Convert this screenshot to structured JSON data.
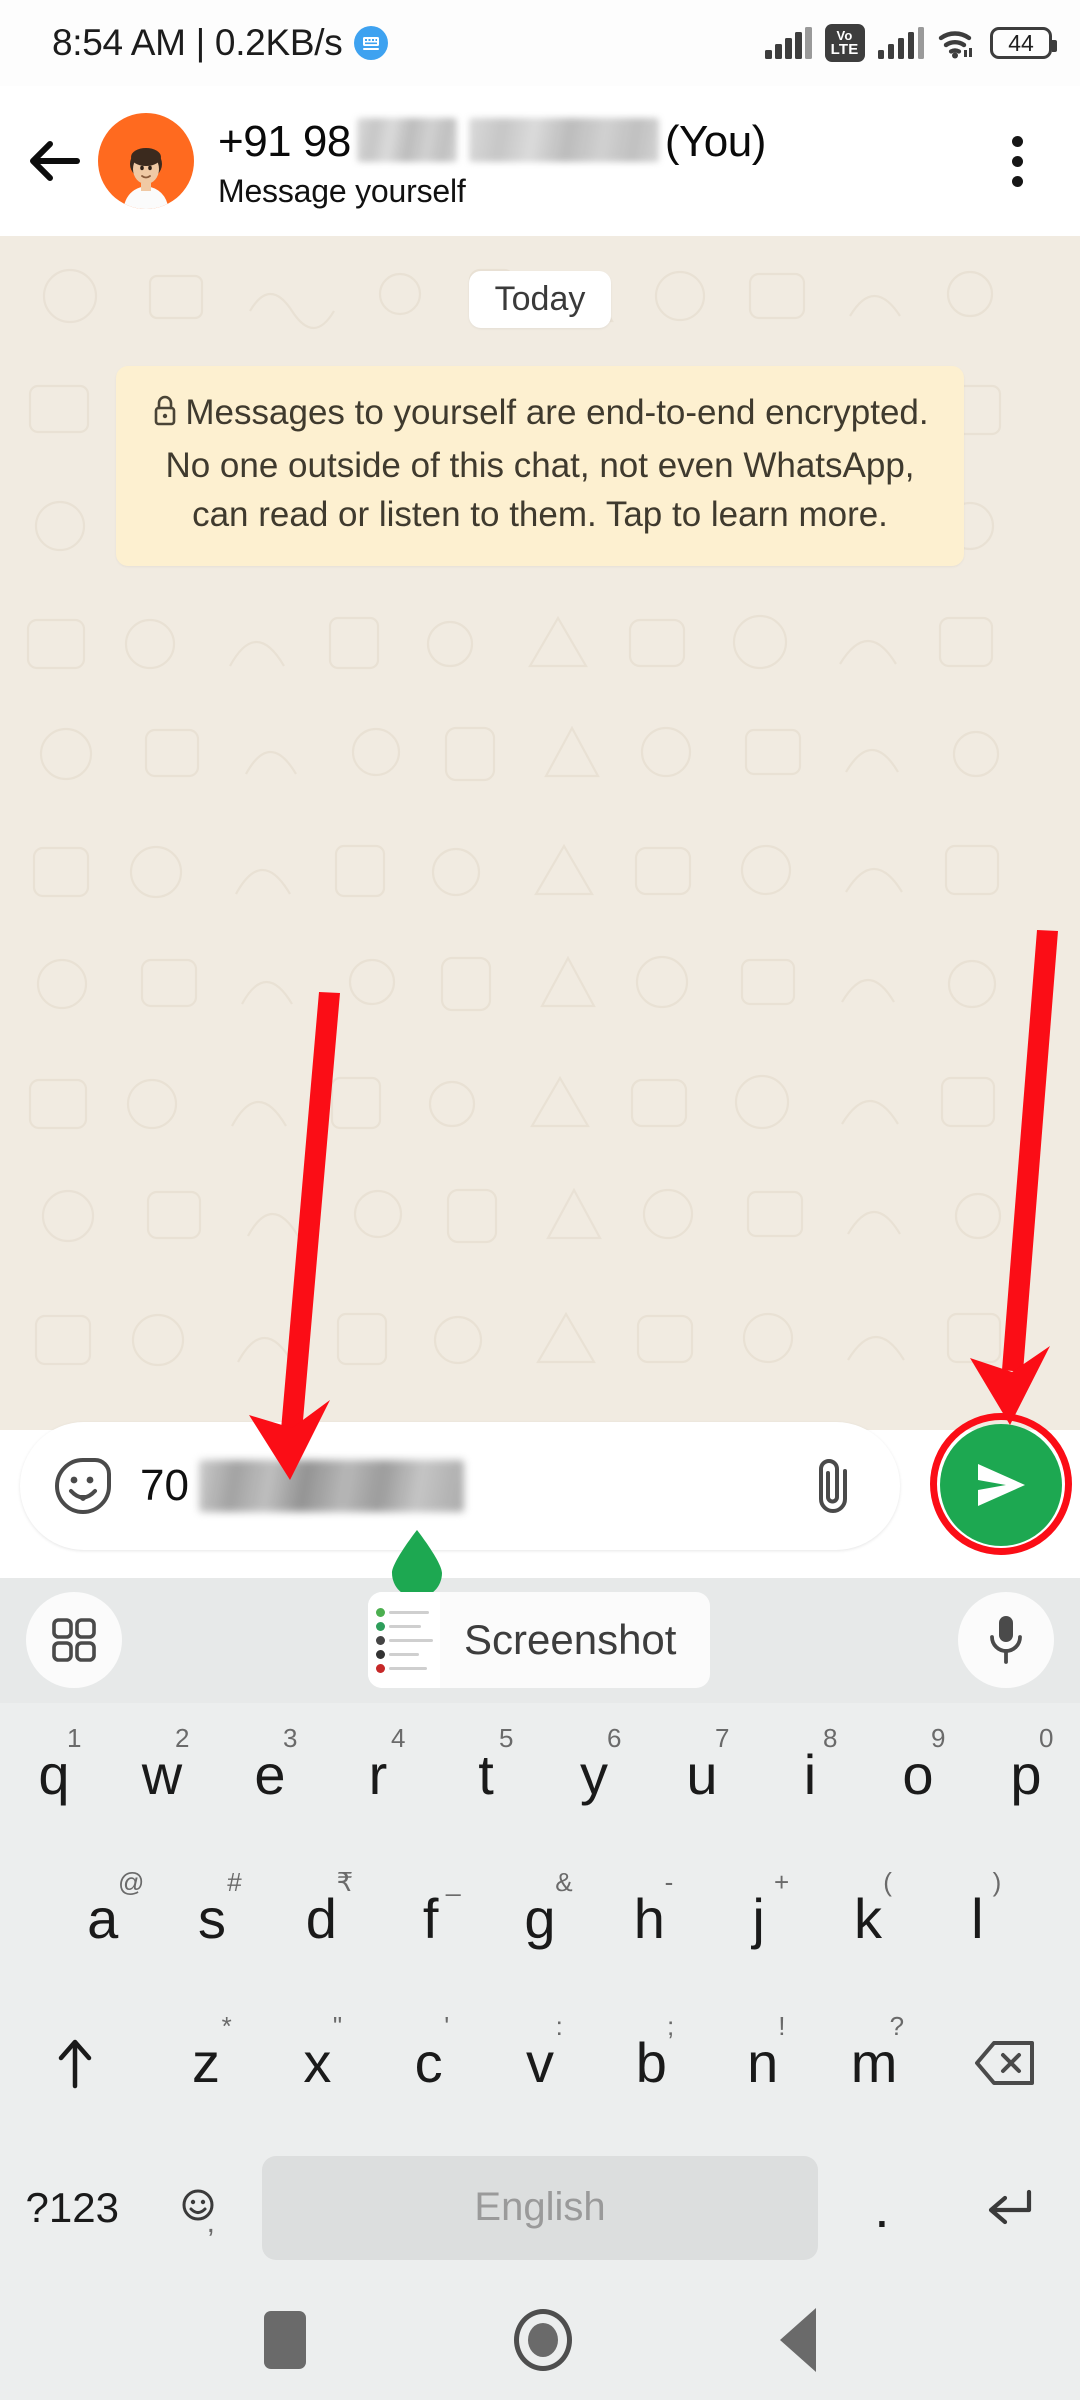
{
  "status_bar": {
    "time": "8:54 AM | 0.2KB/s",
    "network_badge_icon": "data-saver-icon",
    "signal_icon": "signal-bars-icon",
    "volte_line1": "Vo",
    "volte_line2": "LTE",
    "signal2_icon": "signal-bars-icon",
    "wifi_icon": "wifi-icon",
    "battery_level": "44"
  },
  "app_bar": {
    "back_icon": "back-arrow-icon",
    "avatar_icon": "contact-avatar",
    "title_prefix": "+91 98",
    "title_suffix": "(You)",
    "subtitle": "Message yourself",
    "menu_icon": "overflow-menu-icon"
  },
  "chat": {
    "day_chip": "Today",
    "lock_icon": "lock-icon",
    "encryption_notice": "Messages to yourself are end-to-end encrypted. No one outside of this chat, not even WhatsApp, can read or listen to them. Tap to learn more."
  },
  "annotations": {
    "arrow_left_target": "message-input-field",
    "arrow_right_target": "send-button",
    "highlight_color": "#fb0d16"
  },
  "input_bar": {
    "sticker_icon": "sticker-emoji-icon",
    "message_value": "70",
    "attach_icon": "paperclip-icon",
    "send_icon": "send-plane-icon",
    "send_button_color": "#1da851",
    "cursor_handle_color": "#1da851"
  },
  "suggestion_bar": {
    "left_icon": "grid-apps-icon",
    "clipboard_chip_label": "Screenshot",
    "clipboard_thumb_icon": "screenshot-thumbnail",
    "right_icon": "microphone-icon"
  },
  "keyboard": {
    "row1": [
      {
        "main": "q",
        "sup": "1"
      },
      {
        "main": "w",
        "sup": "2"
      },
      {
        "main": "e",
        "sup": "3"
      },
      {
        "main": "r",
        "sup": "4"
      },
      {
        "main": "t",
        "sup": "5"
      },
      {
        "main": "y",
        "sup": "6"
      },
      {
        "main": "u",
        "sup": "7"
      },
      {
        "main": "i",
        "sup": "8"
      },
      {
        "main": "o",
        "sup": "9"
      },
      {
        "main": "p",
        "sup": "0"
      }
    ],
    "row2": [
      {
        "main": "a",
        "sup": "@"
      },
      {
        "main": "s",
        "sup": "#"
      },
      {
        "main": "d",
        "sup": "₹"
      },
      {
        "main": "f",
        "sup": "_"
      },
      {
        "main": "g",
        "sup": "&"
      },
      {
        "main": "h",
        "sup": "-"
      },
      {
        "main": "j",
        "sup": "+"
      },
      {
        "main": "k",
        "sup": "("
      },
      {
        "main": "l",
        "sup": ")"
      }
    ],
    "row3": [
      {
        "main": "z",
        "sup": "*"
      },
      {
        "main": "x",
        "sup": "\""
      },
      {
        "main": "c",
        "sup": "'"
      },
      {
        "main": "v",
        "sup": ":"
      },
      {
        "main": "b",
        "sup": ";"
      },
      {
        "main": "n",
        "sup": "!"
      },
      {
        "main": "m",
        "sup": "?"
      }
    ],
    "shift_icon": "shift-arrow-icon",
    "backspace_icon": "backspace-icon",
    "symbols_label": "?123",
    "emoji_icon": "emoji-icon",
    "emoji_sup": ",",
    "space_label": "English",
    "period_label": ".",
    "enter_icon": "enter-return-icon"
  },
  "nav_bar": {
    "recents_icon": "recents-icon",
    "home_icon": "home-icon",
    "back_icon": "nav-back-icon"
  }
}
